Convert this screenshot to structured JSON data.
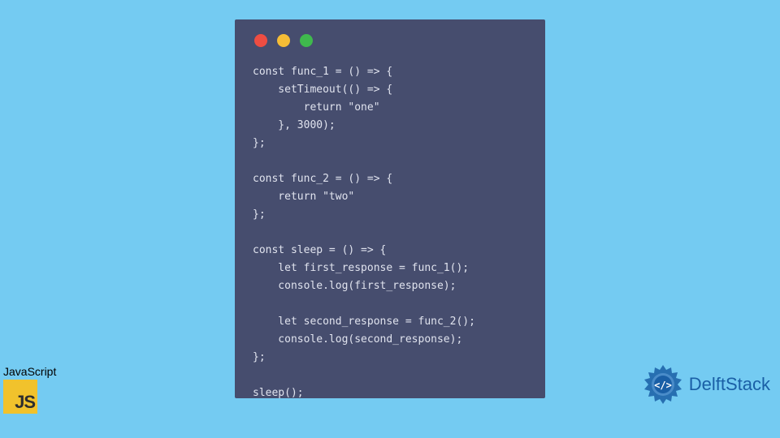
{
  "colors": {
    "background": "#74cbf2",
    "editor_bg": "#464d6e",
    "code_text": "#e0e3ee",
    "traffic_red": "#ee4d42",
    "traffic_yellow": "#f5bd36",
    "traffic_green": "#3fb94d",
    "js_logo_bg": "#f1c22c",
    "delft_accent": "#1a5fa6"
  },
  "code": "const func_1 = () => {\n    setTimeout(() => {\n        return \"one\"\n    }, 3000);\n};\n\nconst func_2 = () => {\n    return \"two\"\n};\n\nconst sleep = () => {\n    let first_response = func_1();\n    console.log(first_response);\n\n    let second_response = func_2();\n    console.log(second_response);\n};\n\nsleep();",
  "js_badge": {
    "label": "JavaScript",
    "logo_text": "JS"
  },
  "delft_badge": {
    "text": "DelftStack"
  }
}
